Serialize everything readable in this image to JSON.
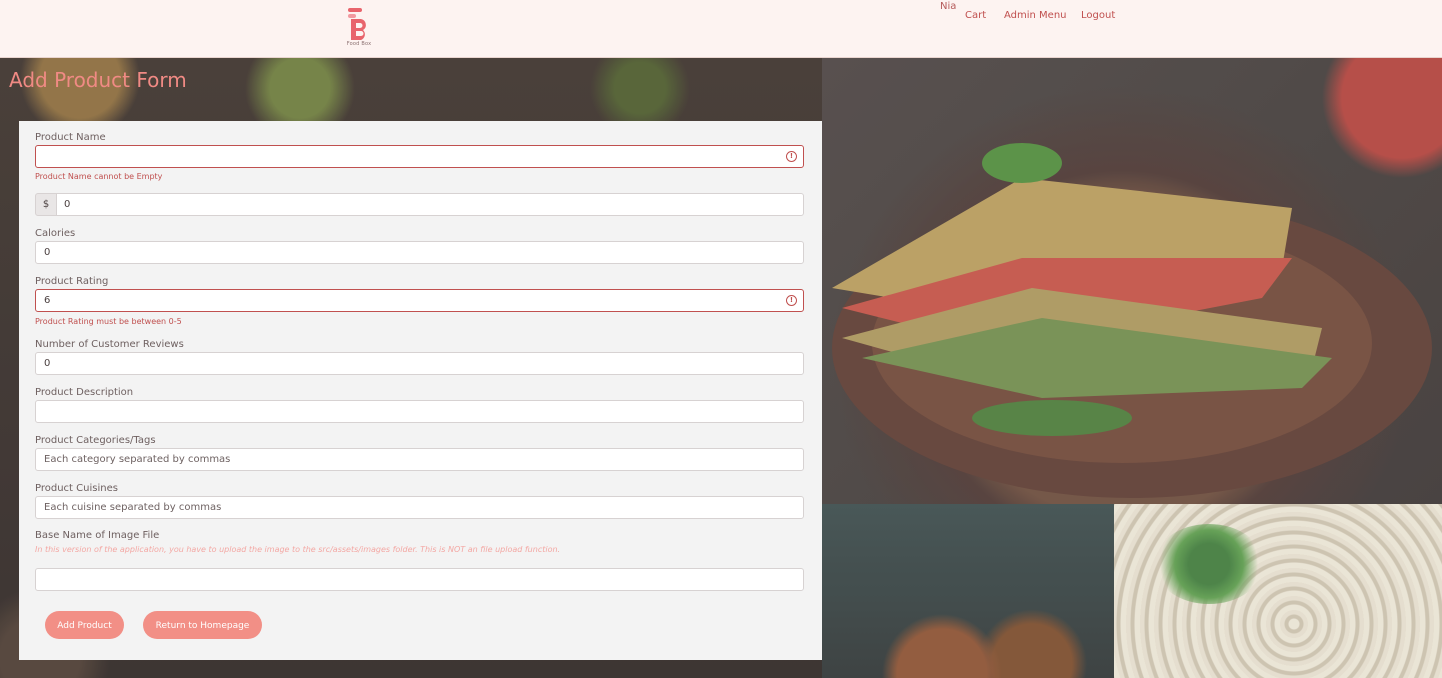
{
  "header": {
    "logo_caption": "Food Box",
    "user_name": "Nia",
    "nav": {
      "cart": "Cart",
      "admin_menu": "Admin Menu",
      "logout": "Logout"
    }
  },
  "page": {
    "title": "Add Product Form"
  },
  "form": {
    "product_name": {
      "label": "Product Name",
      "value": "",
      "error": "Product Name cannot be Empty"
    },
    "price": {
      "prefix": "$",
      "value": "0"
    },
    "calories": {
      "label": "Calories",
      "value": "0"
    },
    "rating": {
      "label": "Product Rating",
      "value": "6",
      "error": "Product Rating must be between 0-5"
    },
    "reviews": {
      "label": "Number of Customer Reviews",
      "value": "0"
    },
    "description": {
      "label": "Product Description",
      "value": ""
    },
    "categories": {
      "label": "Product Categories/Tags",
      "placeholder": "Each category separated by commas"
    },
    "cuisines": {
      "label": "Product Cuisines",
      "placeholder": "Each cuisine separated by commas"
    },
    "image": {
      "label": "Base Name of Image File",
      "note": "In this version of the application, you have to upload the image to the src/assets/images folder. This is NOT an file upload function.",
      "value": ""
    },
    "buttons": {
      "add": "Add Product",
      "home": "Return to Homepage"
    }
  },
  "colors": {
    "accent": "#f28f86",
    "error": "#c0504f",
    "nav_bg": "#fdf3f1"
  },
  "icons": {
    "error": "alert-circle-icon"
  }
}
